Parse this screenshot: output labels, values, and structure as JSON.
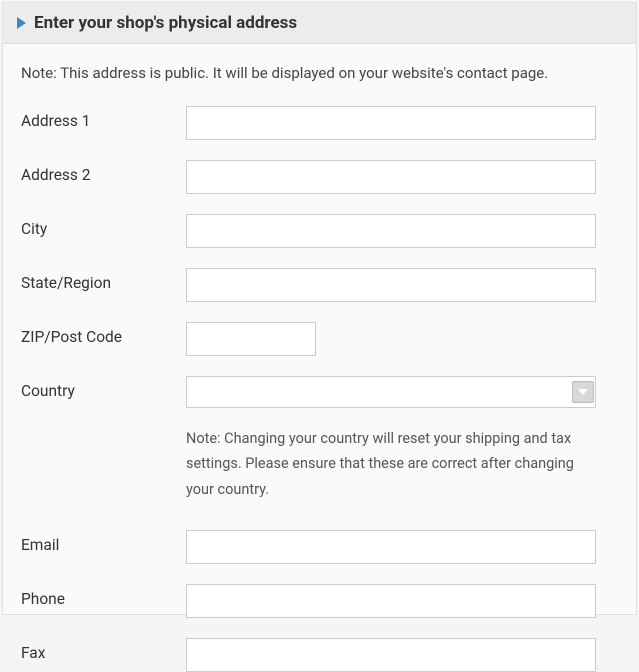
{
  "header": {
    "title": "Enter your shop's physical address"
  },
  "note": "Note: This address is public. It will be displayed on your website's contact page.",
  "fields": {
    "address1": {
      "label": "Address 1",
      "value": ""
    },
    "address2": {
      "label": "Address 2",
      "value": ""
    },
    "city": {
      "label": "City",
      "value": ""
    },
    "state": {
      "label": "State/Region",
      "value": ""
    },
    "zip": {
      "label": "ZIP/Post Code",
      "value": ""
    },
    "country": {
      "label": "Country",
      "value": "",
      "note": "Note: Changing your country will reset your shipping and tax settings. Please ensure that these are correct after changing your country."
    },
    "email": {
      "label": "Email",
      "value": ""
    },
    "phone": {
      "label": "Phone",
      "value": ""
    },
    "fax": {
      "label": "Fax",
      "value": ""
    }
  }
}
